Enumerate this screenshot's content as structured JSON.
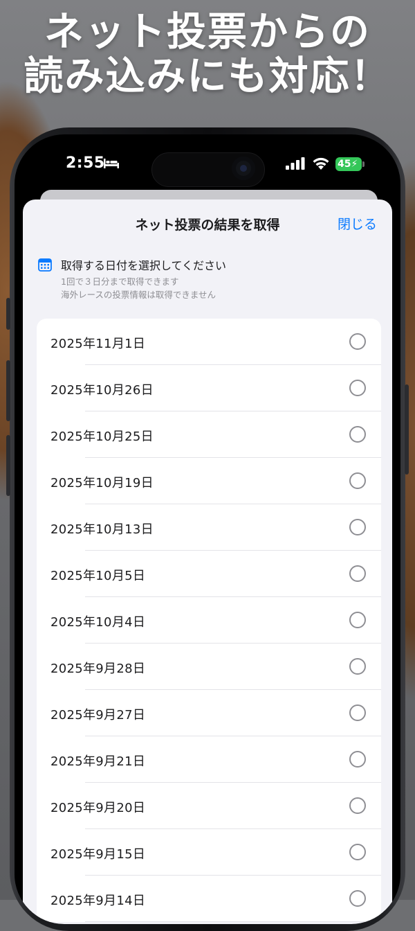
{
  "banner": {
    "line1": "ネット投票からの",
    "line2": "読み込みにも対応！"
  },
  "status_bar": {
    "time": "2:55",
    "battery": "45"
  },
  "sheet": {
    "title": "ネット投票の結果を取得",
    "close_label": "閉じる",
    "info_title": "取得する日付を選択してください",
    "info_line1": "1回で３日分まで取得できます",
    "info_line2": "海外レースの投票情報は取得できません"
  },
  "dates": [
    "2025年11月1日",
    "2025年10月26日",
    "2025年10月25日",
    "2025年10月19日",
    "2025年10月13日",
    "2025年10月5日",
    "2025年10月4日",
    "2025年9月28日",
    "2025年9月27日",
    "2025年9月21日",
    "2025年9月20日",
    "2025年9月15日",
    "2025年9月14日"
  ],
  "colors": {
    "accent": "#0a7aff",
    "battery": "#34c759",
    "sheet_background": "#f2f2f7"
  }
}
